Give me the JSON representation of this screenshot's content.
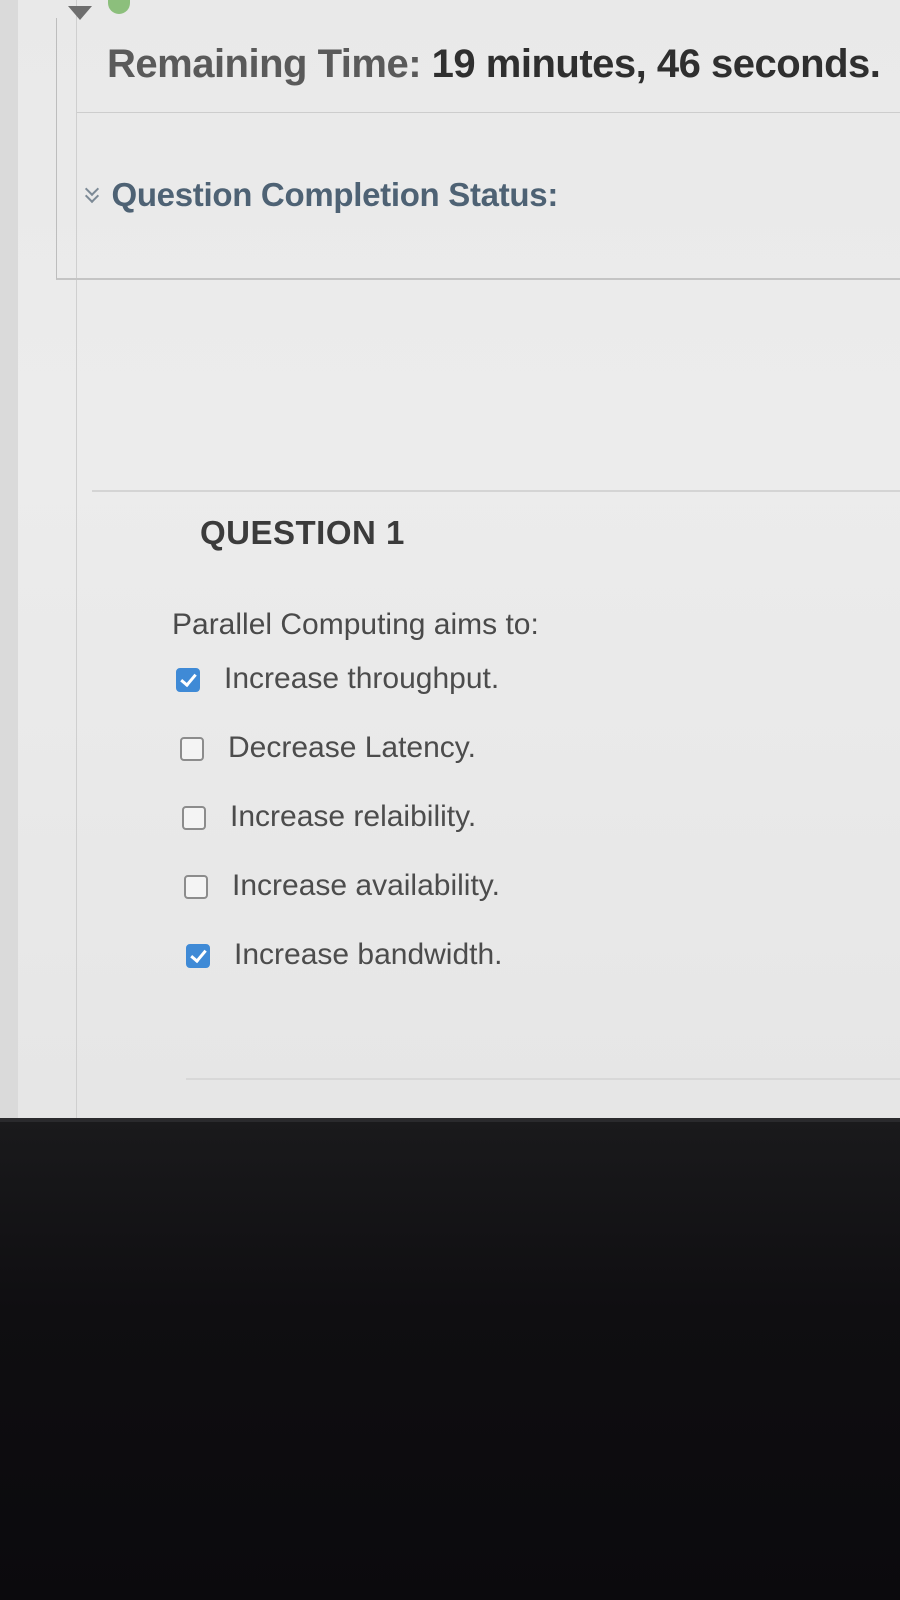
{
  "timer": {
    "label": "Remaining Time:",
    "value": "19 minutes, 46 seconds."
  },
  "completion": {
    "label": "Question Completion Status:"
  },
  "question": {
    "title": "QUESTION 1",
    "prompt": "Parallel Computing aims to:",
    "answers": [
      {
        "label": "Increase throughput.",
        "checked": true
      },
      {
        "label": "Decrease Latency.",
        "checked": false
      },
      {
        "label": "Increase relaibility.",
        "checked": false
      },
      {
        "label": "Increase availability.",
        "checked": false
      },
      {
        "label": "Increase bandwidth.",
        "checked": true
      }
    ]
  },
  "colors": {
    "checkbox_checked": "#3f8ad6",
    "completion_label": "#4e6274",
    "status_dot": "#8cbf7c"
  },
  "icons": {
    "collapse": "double-chevron-down-icon",
    "top_left": "triangle-down-icon",
    "status": "status-dot-icon"
  }
}
